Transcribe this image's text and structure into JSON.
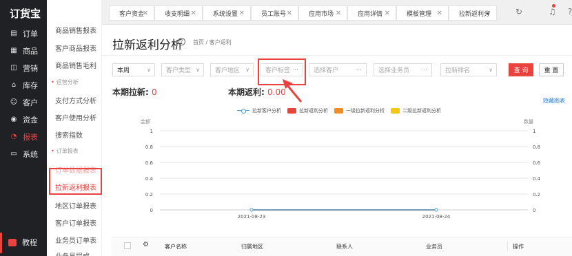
{
  "app": {
    "logo": "订货宝"
  },
  "sidebar": {
    "items": [
      {
        "label": "订单",
        "icon": "order-icon"
      },
      {
        "label": "商品",
        "icon": "product-icon"
      },
      {
        "label": "营销",
        "icon": "marketing-icon"
      },
      {
        "label": "库存",
        "icon": "inventory-icon"
      },
      {
        "label": "客户",
        "icon": "customer-icon"
      },
      {
        "label": "资金",
        "icon": "finance-icon"
      },
      {
        "label": "报表",
        "icon": "report-icon"
      },
      {
        "label": "系统",
        "icon": "system-icon"
      }
    ],
    "tutorial": "教程"
  },
  "submenu": {
    "items": [
      "商品销售报表",
      "客户商品报表",
      "商品销售毛利"
    ],
    "group1": "运营分析",
    "group1_items": [
      "支付方式分析",
      "客户使用分析",
      "搜索指数"
    ],
    "group2": "订单报表",
    "group2_items": [
      "订单数据报表",
      "拉新返利报表",
      "地区订单报表",
      "客户订单报表",
      "业务员订单表",
      "业务员提成"
    ]
  },
  "tabs": [
    {
      "label": "客户资金"
    },
    {
      "label": "收支明细"
    },
    {
      "label": "系统设置"
    },
    {
      "label": "员工账号"
    },
    {
      "label": "应用市场"
    },
    {
      "label": "应用详情"
    },
    {
      "label": "模板管理"
    },
    {
      "label": "拉新返利分"
    }
  ],
  "page": {
    "title": "拉新返利分析",
    "breadcrumb": "首页 / 客户返利"
  },
  "filters": {
    "period": "本周",
    "customer_type": "客户类型",
    "customer_region": "客户地区",
    "customer_tag": "客户标签",
    "select_customer": "选择客户",
    "select_salesman": "选择业务员",
    "referral_rank": "拉新排名",
    "query": "查 询",
    "reset": "重 置"
  },
  "stats": {
    "new_label": "本期拉新:",
    "new_value": "0",
    "rebate_label": "本期返利:",
    "rebate_value": "0.00"
  },
  "hide_chart": "隐藏图表",
  "chart_data": {
    "type": "line",
    "ylabel_left": "金额",
    "ylabel_right": "数量",
    "x": [
      "2021-08-23",
      "2021-08-24"
    ],
    "ylim": [
      0,
      1
    ],
    "yticks": [
      "0",
      "0.2",
      "0.4",
      "0.6",
      "0.8",
      "1"
    ],
    "grid": true,
    "legend_position": "top",
    "series": [
      {
        "name": "拉新客户分析",
        "values": [
          0,
          0
        ],
        "color": "#4aa3df"
      },
      {
        "name": "拉新返利分析",
        "values": [
          0,
          0
        ],
        "color": "#e8433f"
      },
      {
        "name": "一级拉新返利分析",
        "values": [
          0,
          0
        ],
        "color": "#f28c28"
      },
      {
        "name": "二级拉新返利分析",
        "values": [
          0,
          0
        ],
        "color": "#f5c518"
      }
    ]
  },
  "table": {
    "headers": [
      "客户名称",
      "归属地区",
      "联系人",
      "业务员",
      "操作"
    ]
  },
  "colors": {
    "accent": "#e8433f",
    "sidebar_bg": "#1f2124",
    "link": "#2a7fd4"
  }
}
